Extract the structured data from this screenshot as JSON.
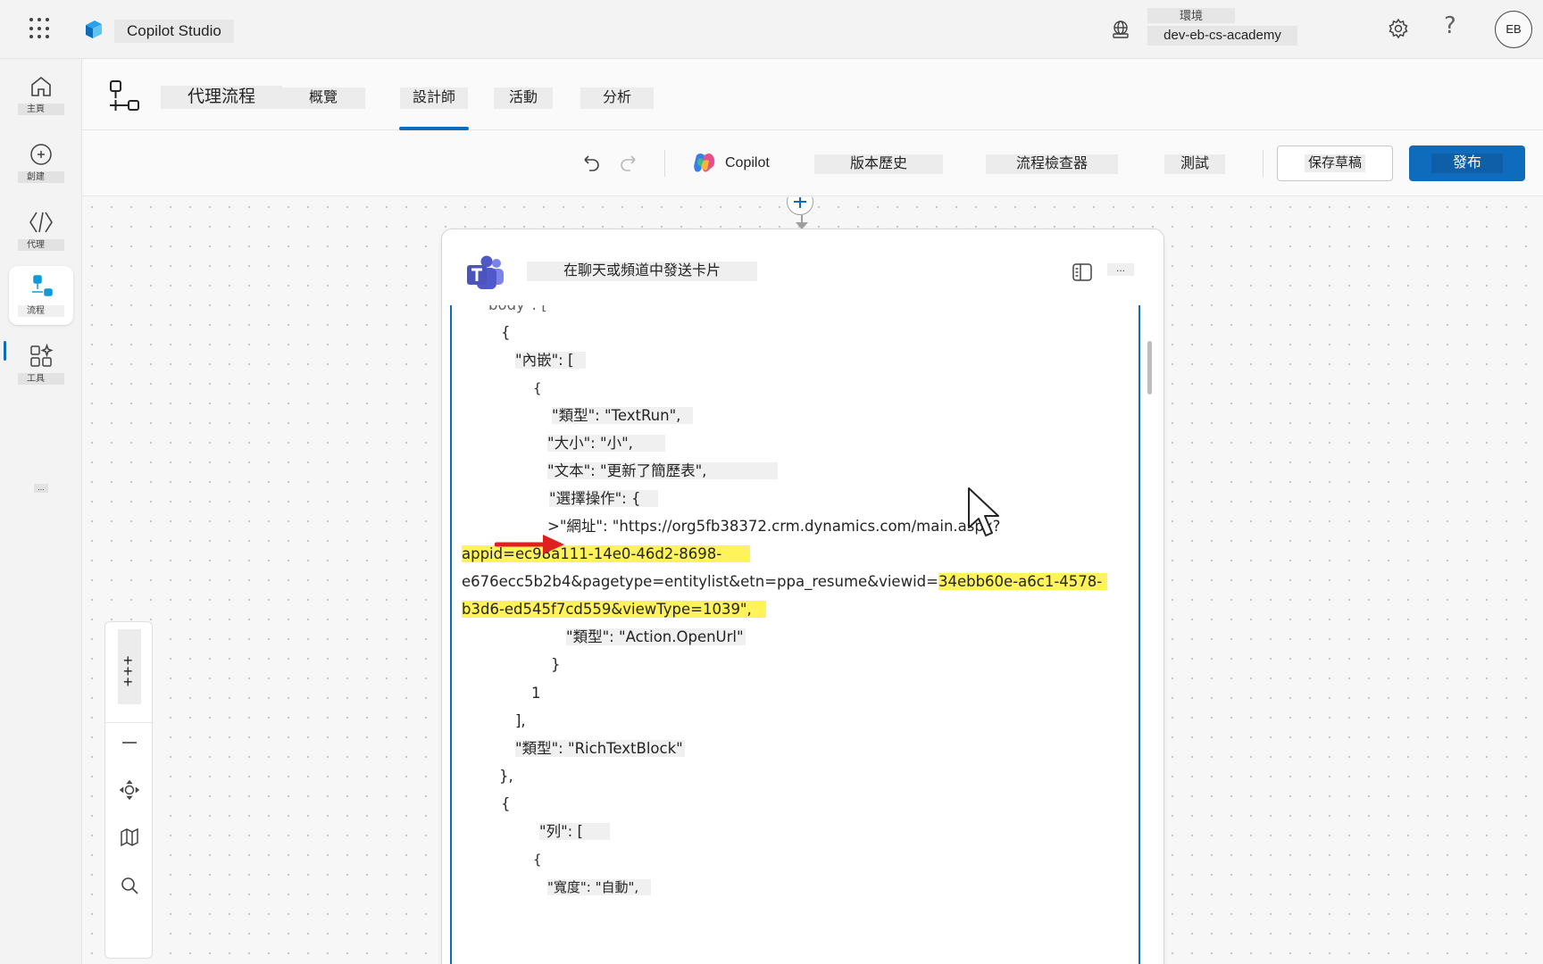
{
  "topbar": {
    "app_title": "Copilot Studio",
    "environment_label": "環境",
    "environment_name": "dev-eb-cs-academy",
    "avatar_initials": "EB",
    "help_glyph": "?",
    "icons": [
      "waffle-icon",
      "copilot-studio-logo",
      "environment-icon",
      "gear-icon",
      "help-icon"
    ]
  },
  "rail": {
    "items": [
      {
        "label": "主頁",
        "icon": "home-icon"
      },
      {
        "label": "創建",
        "icon": "add-icon"
      },
      {
        "label": "代理",
        "icon": "agent-icon"
      },
      {
        "label": "流程",
        "icon": "flow-icon",
        "active": true
      },
      {
        "label": "工具",
        "icon": "tools-icon"
      }
    ],
    "more": "..."
  },
  "header": {
    "title": "代理流程",
    "tabs": [
      {
        "label": "概覽"
      },
      {
        "label": "設計師",
        "selected": true
      },
      {
        "label": "活動"
      },
      {
        "label": "分析"
      }
    ]
  },
  "toolbar": {
    "copilot": "Copilot",
    "version_history": "版本歷史",
    "flow_checker": "流程檢查器",
    "test": "測試",
    "save_draft": "保存草稿",
    "publish": "發布",
    "accent": "#0f6cbd"
  },
  "card": {
    "title": "在聊天或頻道中發送卡片",
    "more": "...",
    "code_lines": [
      "body\": [",
      "{",
      "\"內嵌\": [",
      "{",
      "\"類型\": \"TextRun\",",
      "\"大小\": \"小\",",
      "\"文本\": \"更新了簡歷表\",",
      "\"選擇操作\": {",
      ">\"網址\": \"https://org5fb38372.crm.dynamics.com/main.aspx?",
      "appid=ec98a111-14e0-46d2-8698-",
      "e676ecc5b2b4&pagetype=entitylist&etn=ppa_resume&viewid=",
      "34ebb60e-a6c1-4578-",
      "b3d6-ed545f7cd559&viewType=1039\",",
      "\"類型\": \"Action.OpenUrl\"",
      "}",
      "1",
      "],",
      "\"類型\": \"RichTextBlock\"",
      "},",
      "{",
      "\"列\": [",
      "{",
      "\"寬度\": \"自動\","
    ],
    "highlight_color": "#fff35c",
    "arrow_color": "#e02020"
  },
  "zoom": {
    "zoom_in": "+",
    "icons": [
      "zoom-in-icon",
      "zoom-out-icon",
      "fit-view-icon",
      "minimap-icon",
      "search-icon"
    ]
  }
}
